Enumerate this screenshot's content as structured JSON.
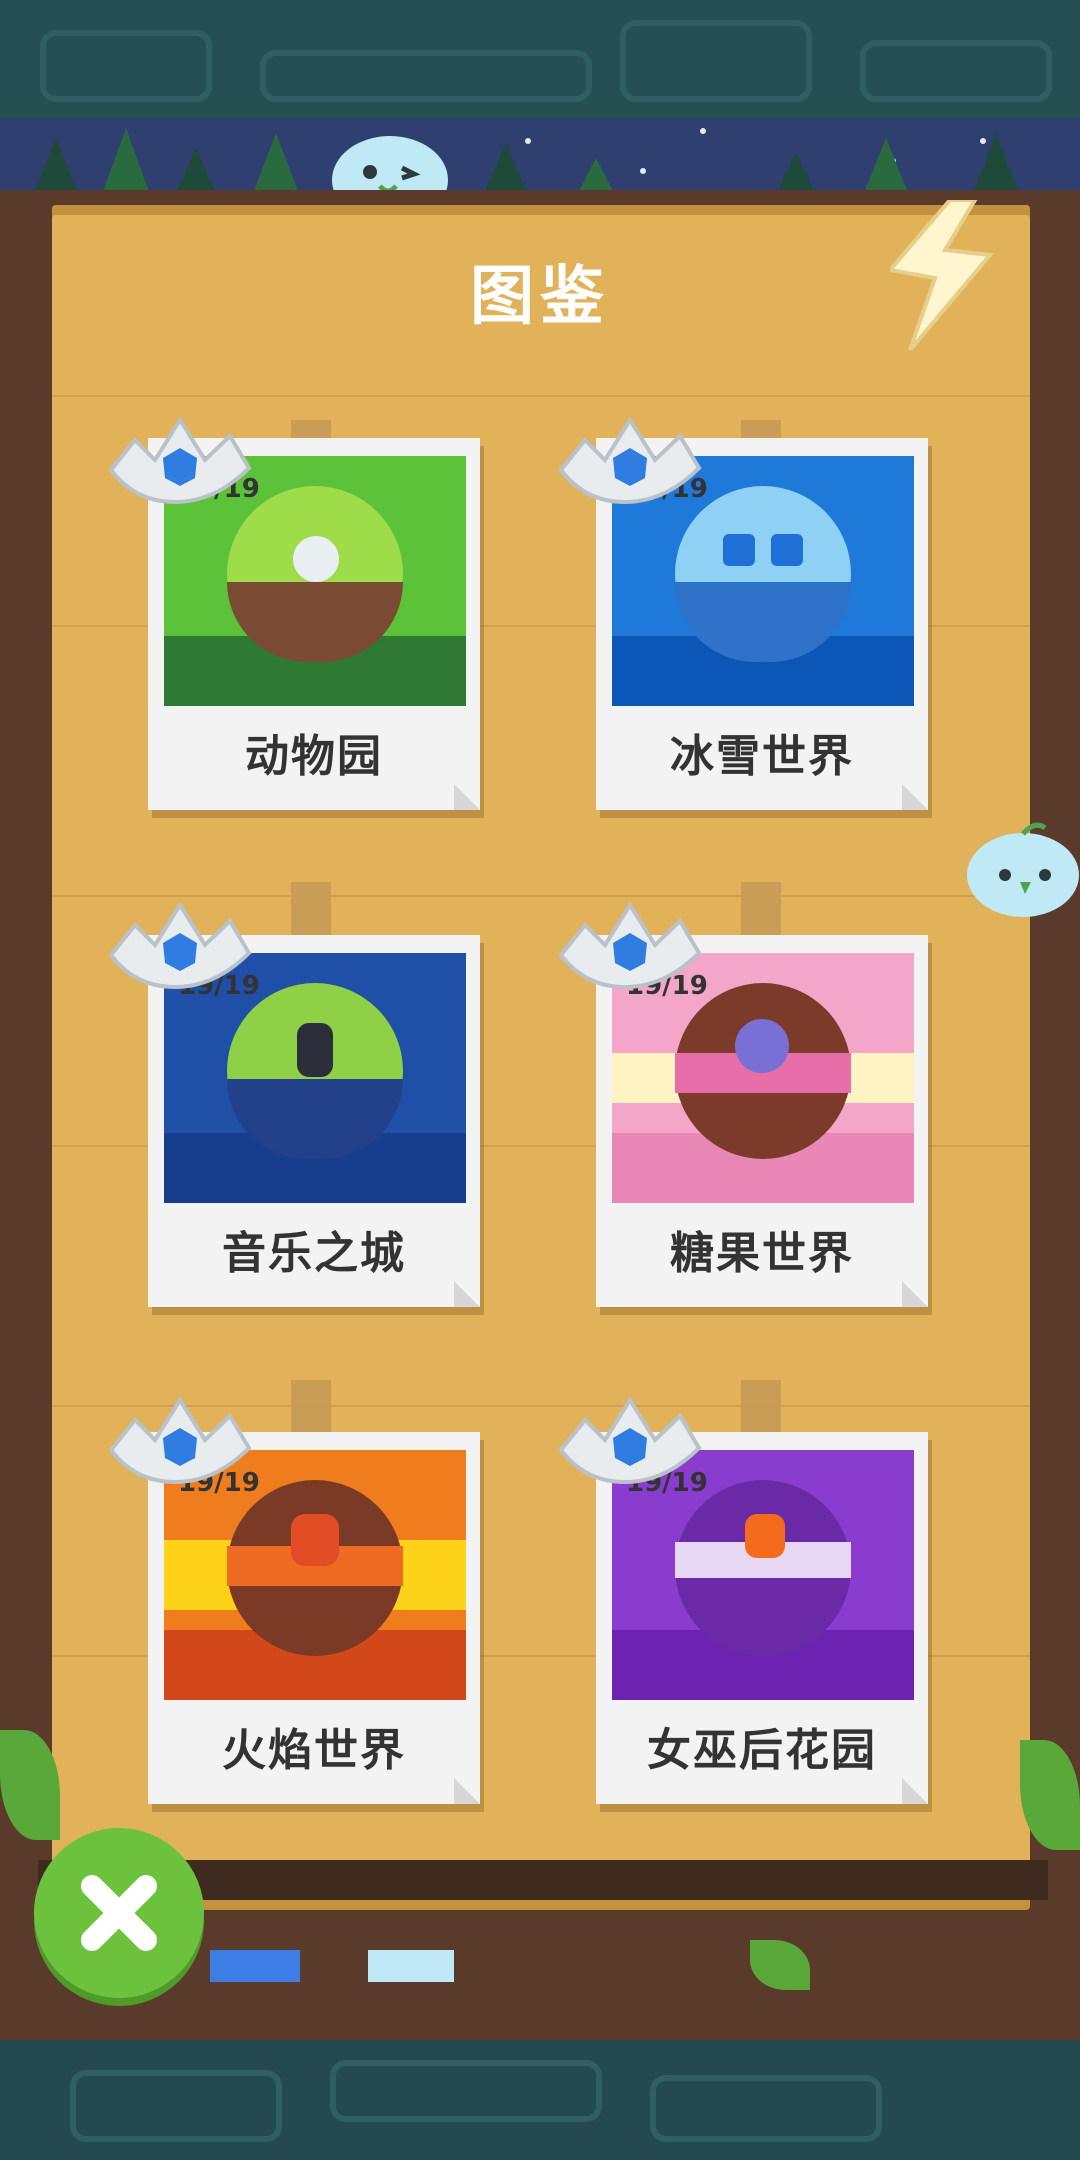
{
  "title": "图鉴",
  "colors": {
    "board": "#e2b25a",
    "frame": "#5a3a2a",
    "close_button": "#6dc23d",
    "card": "#f3f3f3"
  },
  "worlds": [
    {
      "name": "动物园",
      "count": "19/19",
      "bg": "#5cc23a",
      "ball": "#9fdc4a",
      "ground": "#2e7a35"
    },
    {
      "name": "冰雪世界",
      "count": "19/19",
      "bg": "#1e79d8",
      "ball": "#8fd0f5",
      "ground": "#0c56b8"
    },
    {
      "name": "音乐之城",
      "count": "19/19",
      "bg": "#1f4fa6",
      "ball": "#8ed046",
      "ground": "#163e8c"
    },
    {
      "name": "糖果世界",
      "count": "19/19",
      "bg": "#f4a6c8",
      "ball": "#7b3a2a",
      "ground": "#e987b6"
    },
    {
      "name": "火焰世界",
      "count": "19/19",
      "bg": "#f07d1d",
      "ball": "#7a3a26",
      "ground": "#d2481a"
    },
    {
      "name": "女巫后花园",
      "count": "19/19",
      "bg": "#8a3ccf",
      "ball": "#6a2aa8",
      "ground": "#6d23b1"
    }
  ],
  "close_button": {
    "icon": "close-icon"
  }
}
